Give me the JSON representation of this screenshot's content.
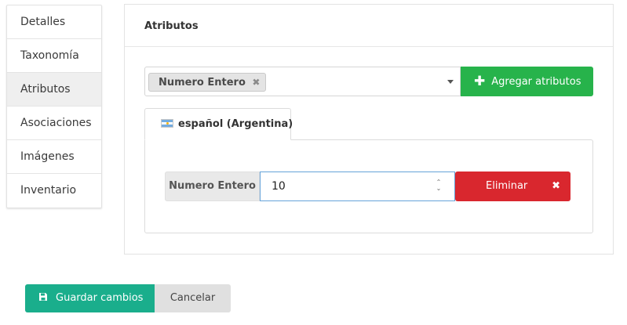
{
  "sidebar": {
    "items": [
      {
        "label": "Detalles"
      },
      {
        "label": "Taxonomía"
      },
      {
        "label": "Atributos",
        "active": true
      },
      {
        "label": "Asociaciones"
      },
      {
        "label": "Imágenes"
      },
      {
        "label": "Inventario"
      }
    ]
  },
  "panel": {
    "title": "Atributos",
    "select": {
      "tags": [
        {
          "label": "Numero Entero",
          "remove_glyph": "✖"
        }
      ],
      "icon": "chevron-down-icon"
    },
    "add_button": {
      "label": "Agregar atributos",
      "icon": "plus-icon"
    },
    "tabs": [
      {
        "label": "español (Argentina)",
        "icon": "argentina-flag-icon"
      }
    ],
    "attribute_row": {
      "label": "Numero Entero",
      "value": "10",
      "delete_label": "Eliminar",
      "delete_icon": "close-icon"
    }
  },
  "footer": {
    "save_label": "Guardar cambios",
    "save_icon": "save-icon",
    "cancel_label": "Cancelar"
  },
  "colors": {
    "add_button": "#27b34b",
    "delete_button": "#d9272e",
    "save_button": "#1aae8c",
    "input_focus_border": "#66a3d9"
  }
}
